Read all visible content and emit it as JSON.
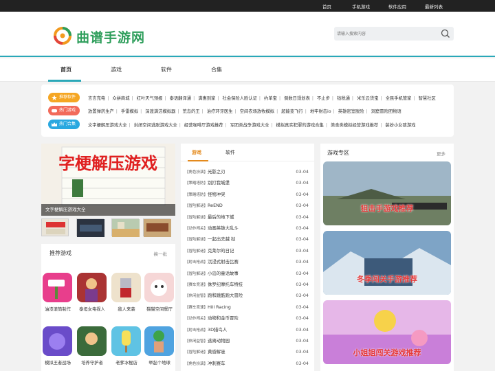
{
  "topnav": {
    "items": [
      "首页",
      "手机游戏",
      "软件应用",
      "最新列表"
    ]
  },
  "site": {
    "title": "曲谱手游网"
  },
  "search": {
    "placeholder": "请输入搜索内容"
  },
  "mainnav": {
    "items": [
      "首页",
      "游戏",
      "软件",
      "合集"
    ],
    "active": "首页"
  },
  "tags": [
    {
      "badge": "推荐软件",
      "color": "#f5a623",
      "links": [
        "言言充电",
        "众拼商城",
        "红叶天气预报",
        "泰语翻译通",
        "满惠到家",
        "社会保险人脸认证",
        "约单宝",
        "倒数日规划表",
        "不止步",
        "钱税通",
        "米乐云货宝",
        "全民手机管家",
        "智慧社区"
      ]
    },
    {
      "badge": "热门游戏",
      "color": "#f26b5b",
      "links": [
        "放置弹药生产",
        "手雷模拟",
        "深渡满洁模拟器",
        "荒岛的王",
        "治疗环牙医生",
        "空间农场放牧模拟",
        "超能变飞行",
        "地牢射击io",
        "英雄密室脱险",
        "洞窟冒险团物语"
      ]
    },
    {
      "badge": "热门合集",
      "color": "#2aa8e0",
      "links": [
        "文字梗解压游戏大全",
        "封闭空间逃脱游戏大全",
        "经营咖啡厅游戏推荐",
        "军团类战争游戏大全",
        "模拟真实犯罪的游戏合集",
        "美食类模拟经营游戏推荐",
        "装扮小女孩游戏"
      ]
    }
  ],
  "slider": {
    "caption": "文字梗解压游戏大全",
    "banner_text": "字梗解压游戏"
  },
  "recommend": {
    "title": "推荐游戏",
    "more": "换一批",
    "apps": [
      "油漆滚筒制作",
      "泰坦女电视人",
      "敌人来袭",
      "猫猫空间餐厅",
      "模拟王者战场",
      "培养守护者",
      "老爹冰棍店",
      "举起个地球"
    ]
  },
  "news": {
    "tabs": [
      "游戏",
      "软件"
    ],
    "active_tab": "游戏",
    "items": [
      {
        "cat": "【角色扮演】",
        "title": "光影之刃",
        "date": "03-04"
      },
      {
        "cat": "【策略塔防】",
        "title": "别打我城堡",
        "date": "03-04"
      },
      {
        "cat": "【策略塔防】",
        "title": "怪物冲突",
        "date": "03-04"
      },
      {
        "cat": "【冒险解谜】",
        "title": "ReEND",
        "date": "03-04"
      },
      {
        "cat": "【冒险解谜】",
        "title": "最后的地下城",
        "date": "03-04"
      },
      {
        "cat": "【动作闯关】",
        "title": "动画英雄大乱斗",
        "date": "03-04"
      },
      {
        "cat": "【冒险解谜】",
        "title": "一起出去越 狱",
        "date": "03-04"
      },
      {
        "cat": "【冒险解谜】",
        "title": "克莱尔的日记",
        "date": "03-04"
      },
      {
        "cat": "【射击枪战】",
        "title": "沉浸式射击比赛",
        "date": "03-04"
      },
      {
        "cat": "【冒险解谜】",
        "title": "小岛的童话故事",
        "date": "03-04"
      },
      {
        "cat": "【赛车竞速】",
        "title": "侏罗纪摩托车特技",
        "date": "03-04"
      },
      {
        "cat": "【休闲益智】",
        "title": "跑和跳酷跑大冒险",
        "date": "03-04"
      },
      {
        "cat": "【赛车竞速】",
        "title": "Hill Racing",
        "date": "03-04"
      },
      {
        "cat": "【动作闯关】",
        "title": "动物和金币冒险",
        "date": "03-04"
      },
      {
        "cat": "【射击枪战】",
        "title": "3D猎鸟人",
        "date": "03-04"
      },
      {
        "cat": "【休闲益智】",
        "title": "逃离动物园",
        "date": "03-04"
      },
      {
        "cat": "【冒险解谜】",
        "title": "黄昏解谜",
        "date": "03-04"
      },
      {
        "cat": "【角色扮演】",
        "title": "冲刺赛车",
        "date": "03-04"
      }
    ]
  },
  "zone": {
    "title": "游戏专区",
    "more": "更多",
    "cards": [
      "狙击手游戏推荐",
      "冬季闯关手游推荐",
      "小姐姐闯关游戏推荐"
    ]
  }
}
